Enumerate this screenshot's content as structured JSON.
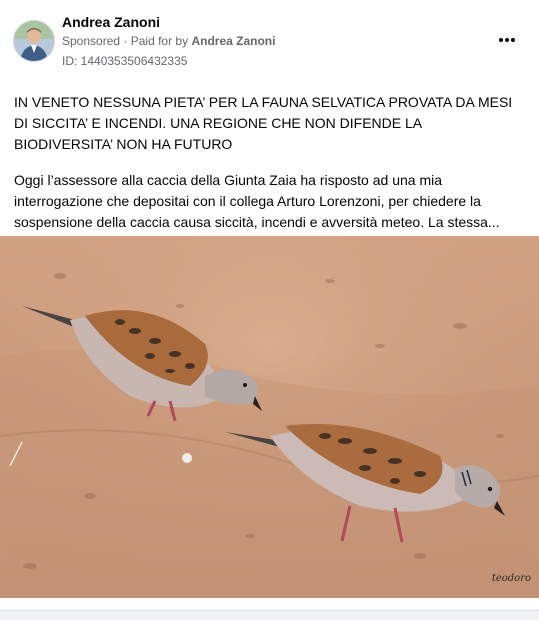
{
  "post": {
    "author_name": "Andrea Zanoni",
    "sponsored_label": "Sponsored",
    "paid_for_prefix": "Paid for by",
    "paid_for_name": "Andrea Zanoni",
    "ad_id": "ID: 1440353506432335",
    "more_icon": "more-horizontal-icon",
    "headline": "IN VENETO NESSUNA PIETA’ PER LA FAUNA SELVATICA PROVATA DA MESI DI SICCITA’ E INCENDI. UNA REGIONE CHE NON DIFENDE LA BIODIVERSITA’ NON HA FUTURO",
    "body": "Oggi l’assessore alla caccia della Giunta Zaia ha risposto ad una mia interrogazione che depositai con il collega Arturo Lorenzoni, per chiedere la sospensione della caccia causa siccità, incendi e avversità meteo. La stessa...",
    "image_signature": "teodoro"
  },
  "colors": {
    "text_primary": "#050505",
    "text_secondary": "#65676b",
    "sand": "#c9997a"
  }
}
